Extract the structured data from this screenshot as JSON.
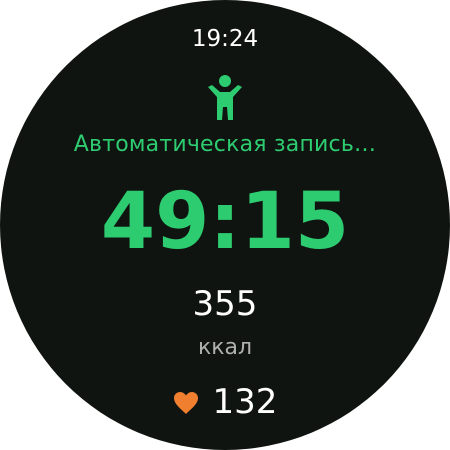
{
  "status_bar": {
    "time": "19:24"
  },
  "activity": {
    "icon": "standing-person-icon",
    "status": "Автоматическая запись…"
  },
  "workout": {
    "duration": "49:15"
  },
  "calories": {
    "value": "355",
    "unit": "ккал"
  },
  "heart_rate": {
    "icon": "heart-icon",
    "value": "132"
  },
  "colors": {
    "background": "#0f1410",
    "accent_green": "#2ecc71",
    "heart_orange": "#f08030",
    "text_primary": "#ffffff",
    "text_secondary": "#b0b0b0"
  }
}
